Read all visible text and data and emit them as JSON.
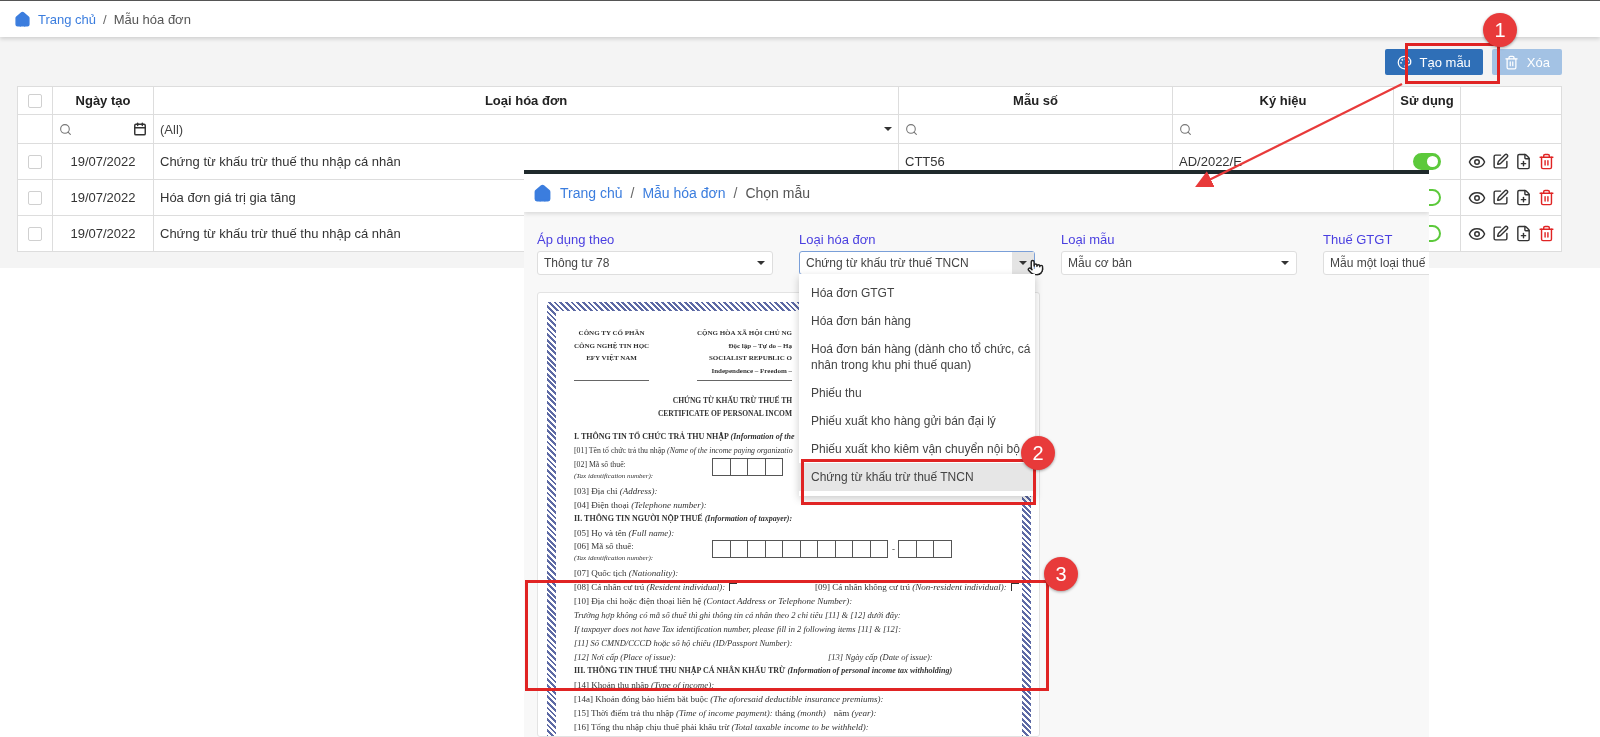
{
  "breadcrumb": [
    {
      "label": "Trang chủ",
      "link": true
    },
    {
      "label": "Mẫu hóa đơn",
      "link": false
    }
  ],
  "breadcrumb_separator": "/",
  "toolbar": [
    {
      "label": "Tạo mẫu",
      "kind": "create",
      "disabled": false
    },
    {
      "label": "Xóa",
      "kind": "delete",
      "disabled": true
    }
  ],
  "table": {
    "all_checked": false,
    "columns": [
      "Ngày tạo",
      "Loại hóa đơn",
      "Mẫu số",
      "Ký hiệu",
      "Sử dụng"
    ],
    "type_filter": "(All)",
    "rows": [
      {
        "checked": false,
        "date": "19/07/2022",
        "type": "Chứng từ khấu trừ thuế thu nhập cá nhân",
        "form_no": "CTT56",
        "symbol": "AD/2022/E",
        "in_use": true
      },
      {
        "checked": false,
        "date": "19/07/2022",
        "type": "Hóa đơn giá trị gia tăng",
        "in_use": false
      },
      {
        "checked": false,
        "date": "19/07/2022",
        "type": "Chứng từ khấu trừ thuế thu nhập cá nhân",
        "in_use": false
      }
    ]
  },
  "dialog": {
    "breadcrumb": [
      {
        "label": "Trang chủ",
        "link": true
      },
      {
        "label": "Mẫu hóa đơn",
        "link": true
      },
      {
        "label": "Chọn mẫu",
        "link": false
      }
    ],
    "breadcrumb_separator": "/",
    "filters": [
      {
        "label": "Áp dụng theo",
        "value": "Thông tư 78",
        "open": false
      },
      {
        "label": "Loại hóa đơn",
        "value": "Chứng từ khấu trừ thuế TNCN",
        "open": true,
        "options": [
          {
            "label": "Hóa đơn GTGT",
            "selected": false
          },
          {
            "label": "Hóa đơn bán hàng",
            "selected": false
          },
          {
            "label": "Hoá đơn bán hàng (dành cho tổ chức, cá nhân trong khu phi thuế quan)",
            "selected": false
          },
          {
            "label": "Phiếu thu",
            "selected": false
          },
          {
            "label": "Phiếu xuất kho hàng gửi bán đại lý",
            "selected": false
          },
          {
            "label": "Phiếu xuất kho kiêm vận chuyển nội bộ",
            "selected": false
          },
          {
            "label": "Chứng từ khấu trừ thuế TNCN",
            "selected": true
          }
        ]
      },
      {
        "label": "Loại mẫu",
        "value": "Mẫu cơ bản",
        "open": false
      },
      {
        "label": "Thuế GTGT",
        "value": "Mẫu một loại thuế",
        "open": false
      }
    ],
    "preview": {
      "left_header": [
        "CÔNG TY CỔ PHẦN",
        "CÔNG NGHỆ TIN HỌC",
        "EFY VIỆT NAM"
      ],
      "right_header": [
        "CỘNG HÒA XÃ HỘI CHỦ NG",
        "Độc lập – Tự do – Hạ",
        "SOCIALIST REPUBLIC O",
        "Independence – Freedom –"
      ],
      "title": [
        "CHỨNG TỪ KHẤU TRỪ THUẾ TH",
        "CERTIFICATE OF PERSONAL INCOM"
      ],
      "lines": [
        {
          "kind": "section",
          "text": "I. THÔNG TIN TỔ CHỨC TRẢ THU NHẬP *(Information of the*"
        },
        {
          "kind": "field",
          "text": "[01] Tên tổ chức trả thu nhập *(Name of the income paying organizatio*"
        },
        {
          "kind": "tax-org",
          "text": "[02] Mã số thuế:",
          "note": "(Tax identification number):"
        },
        {
          "kind": "field",
          "text": "[03] Địa chỉ *(Address):*"
        },
        {
          "kind": "field",
          "text": "[04] Điện thoại *(Telephone number):*"
        },
        {
          "kind": "section",
          "text": "II. THÔNG TIN NGƯỜI NỘP THUẾ *(Information of taxpayer):*"
        },
        {
          "kind": "field",
          "text": "[05] Họ và tên *(Full name):*"
        },
        {
          "kind": "tax-person",
          "text": "[06] Mã số thuế:",
          "note": "(Tax identification number):",
          "dash": "-"
        },
        {
          "kind": "field",
          "text": "[07] Quốc tịch *(Nationality):*"
        },
        {
          "kind": "check-pair",
          "checks": [
            false,
            false
          ],
          "parts": [
            "[08] Cá nhân cư trú *(Resident individual):*",
            "[09] Cá nhân không cư trú *(Non-resident individual):*"
          ]
        },
        {
          "kind": "field",
          "text": "[10] Địa chỉ hoặc điện thoại liên hệ *(Contact Address or Telephone Number):*"
        },
        {
          "kind": "note",
          "text": "Trường hợp không có mã số thuế thì ghi thông tin cá nhân theo 2 chỉ tiêu [11] & [12] dưới đây:"
        },
        {
          "kind": "note",
          "text": "If taxpayer does not have Tax identification number, please fill in 2 following items [11] & [12]:"
        },
        {
          "kind": "note",
          "text": "[11] Số CMND/CCCD hoặc số hộ chiếu (ID/Passport Number):"
        },
        {
          "kind": "note-pair",
          "parts": [
            "[12] Nơi cấp (Place of issue):",
            "[13] Ngày cấp (Date of issue):"
          ]
        },
        {
          "kind": "section",
          "text": "III. THÔNG TIN THUẾ THU NHẬP CÁ NHÂN KHẤU TRỪ *(Information of personal income tax withholding)*"
        },
        {
          "kind": "field",
          "text": "[14] Khoản thu nhập *(Type of income):*"
        },
        {
          "kind": "field",
          "text": "[14a] Khoản đóng bảo hiểm bắt buộc *(The aforesaid deductible insurance premiums):*"
        },
        {
          "kind": "pair",
          "parts": [
            "[15] Thời điểm trả thu nhập *(Time of income payment):* tháng *(month)*",
            "năm *(year):*"
          ]
        },
        {
          "kind": "field",
          "text": "[16] Tổng thu nhập chịu thuế phải khấu trừ *(Total taxable income to be withheld):*"
        }
      ]
    }
  },
  "annotations": [
    {
      "number": "1"
    },
    {
      "number": "2"
    },
    {
      "number": "3"
    }
  ]
}
